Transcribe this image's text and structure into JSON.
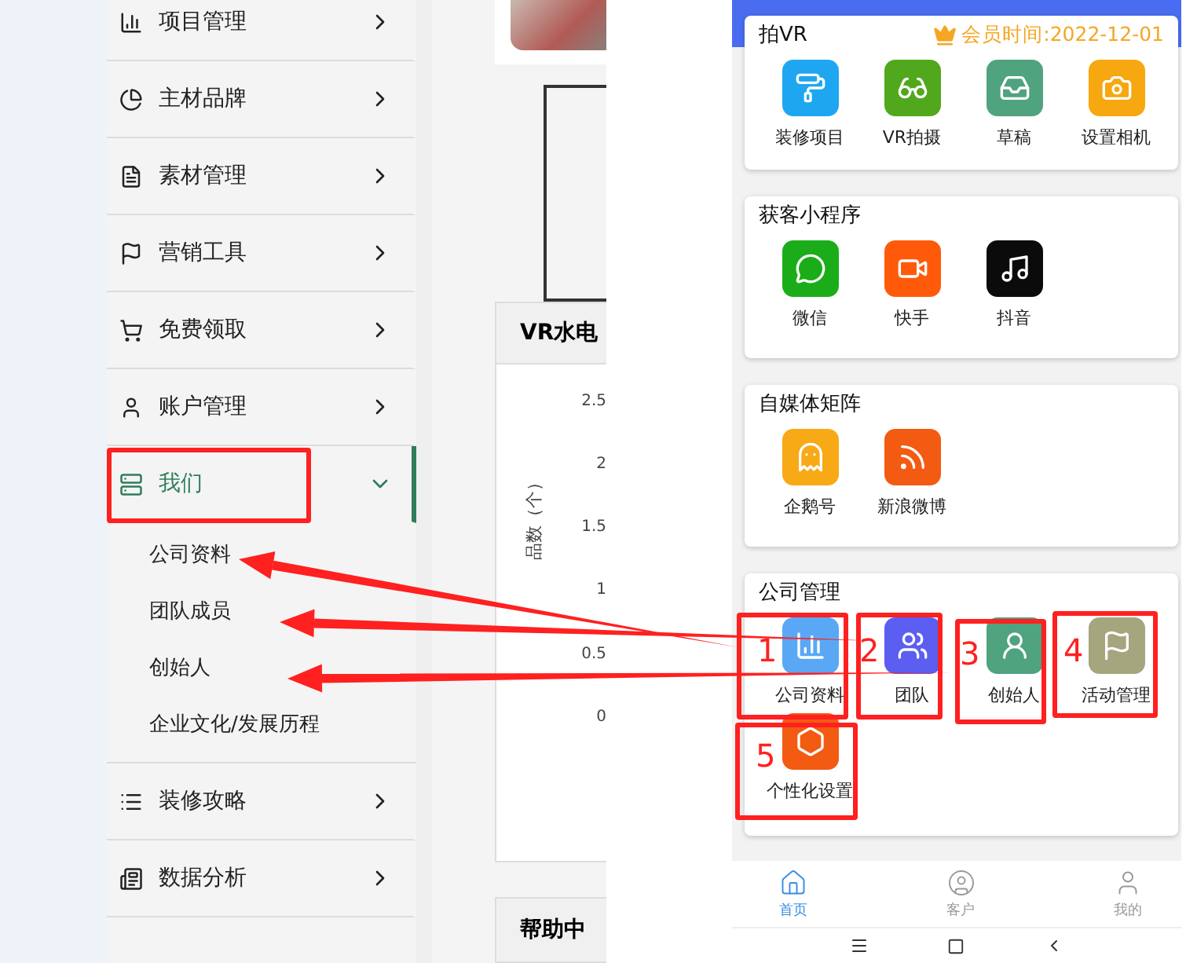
{
  "sidebar": {
    "items": [
      {
        "label": "项目管理",
        "expanded": false
      },
      {
        "label": "主材品牌",
        "expanded": false
      },
      {
        "label": "素材管理",
        "expanded": false
      },
      {
        "label": "营销工具",
        "expanded": false
      },
      {
        "label": "免费领取",
        "expanded": false
      },
      {
        "label": "账户管理",
        "expanded": false
      },
      {
        "label": "我们",
        "expanded": true,
        "children": [
          {
            "label": "公司资料"
          },
          {
            "label": "团队成员"
          },
          {
            "label": "创始人"
          },
          {
            "label": "企业文化/发展历程"
          }
        ]
      },
      {
        "label": "装修攻略",
        "expanded": false
      },
      {
        "label": "数据分析",
        "expanded": false
      }
    ]
  },
  "content": {
    "chart_card": {
      "title": "VR水电",
      "y_ticks": [
        "2.5",
        "2",
        "1.5",
        "1",
        "0.5",
        "0"
      ],
      "ylabel": "品数（个）"
    },
    "help_card": {
      "title": "帮助中"
    }
  },
  "phone": {
    "sections": [
      {
        "title": "拍VR",
        "badge": "会员时间:2022-12-01",
        "tiles": [
          {
            "label": "装修项目",
            "color": "#1ea7f0"
          },
          {
            "label": "VR拍摄",
            "color": "#52a81c"
          },
          {
            "label": "草稿",
            "color": "#4fa37f"
          },
          {
            "label": "设置相机",
            "color": "#f7a70f"
          }
        ]
      },
      {
        "title": "获客小程序",
        "tiles": [
          {
            "label": "微信",
            "color": "#1aad19"
          },
          {
            "label": "快手",
            "color": "#ff5a0a"
          },
          {
            "label": "抖音",
            "color": "#0b0b0b"
          }
        ]
      },
      {
        "title": "自媒体矩阵",
        "tiles": [
          {
            "label": "企鹅号",
            "color": "#f8a916"
          },
          {
            "label": "新浪微博",
            "color": "#f35a12"
          }
        ]
      },
      {
        "title": "公司管理",
        "tiles": [
          {
            "label": "公司资料",
            "color": "#5aa8f5"
          },
          {
            "label": "团队",
            "color": "#5b5ef0"
          },
          {
            "label": "创始人",
            "color": "#4fa37f"
          },
          {
            "label": "活动管理",
            "color": "#a5a57e"
          },
          {
            "label": "个性化设置",
            "color": "#f35a12"
          }
        ]
      }
    ],
    "tabbar": [
      {
        "label": "首页",
        "selected": true
      },
      {
        "label": "客户",
        "selected": false
      },
      {
        "label": "我的",
        "selected": false
      }
    ]
  },
  "annotations": [
    {
      "number": "1"
    },
    {
      "number": "2"
    },
    {
      "number": "3"
    },
    {
      "number": "4"
    },
    {
      "number": "5"
    }
  ]
}
